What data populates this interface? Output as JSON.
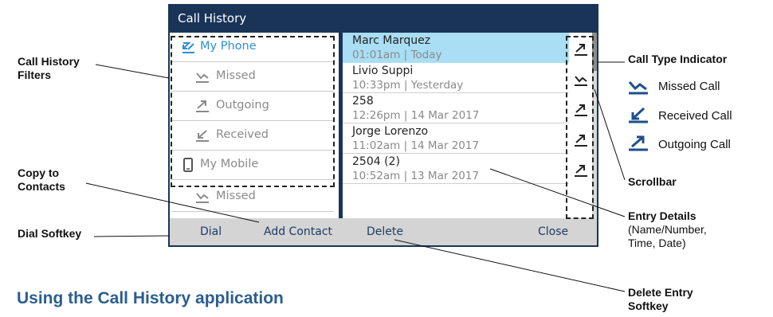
{
  "screen": {
    "title": "Call History",
    "filters": [
      {
        "label": "My Phone",
        "icon": "my-phone-icon",
        "active": true
      },
      {
        "label": "Missed",
        "icon": "missed-call-icon",
        "active": false
      },
      {
        "label": "Outgoing",
        "icon": "outgoing-call-icon",
        "active": false
      },
      {
        "label": "Received",
        "icon": "received-call-icon",
        "active": false
      },
      {
        "label": "My Mobile",
        "icon": "mobile-phone-icon",
        "active": false
      },
      {
        "label": "Missed",
        "icon": "missed-call-icon",
        "active": false
      }
    ],
    "entries": [
      {
        "name": "Marc Marquez",
        "time": "01:01am | Today",
        "type": "outgoing",
        "selected": true
      },
      {
        "name": "Livio Suppi",
        "time": "10:33pm | Yesterday",
        "type": "missed",
        "selected": false
      },
      {
        "name": "258",
        "time": "12:26pm | 14 Mar 2017",
        "type": "outgoing",
        "selected": false
      },
      {
        "name": "Jorge Lorenzo",
        "time": "11:02am | 14 Mar 2017",
        "type": "outgoing",
        "selected": false
      },
      {
        "name": "2504 (2)",
        "time": "10:52am | 13 Mar 2017",
        "type": "outgoing",
        "selected": false
      }
    ],
    "softkeys": {
      "dial": "Dial",
      "add_contact": "Add Contact",
      "delete": "Delete",
      "close": "Close"
    }
  },
  "annotations": {
    "filters_line1": "Call History",
    "filters_line2": "Filters",
    "copy_line1": "Copy to",
    "copy_line2": "Contacts",
    "dial_softkey": "Dial Softkey",
    "call_type_indicator": "Call Type Indicator",
    "legend": {
      "missed": "Missed Call",
      "received": "Received Call",
      "outgoing": "Outgoing Call"
    },
    "scrollbar": "Scrollbar",
    "entry_details_title": "Entry Details",
    "entry_details_line2": "(Name/Number,",
    "entry_details_line3": "Time, Date)",
    "delete_line1": "Delete Entry",
    "delete_line2": "Softkey"
  },
  "heading": "Using the Call History application",
  "colors": {
    "title_bar": "#1a3458",
    "selected_row": "#a9def4",
    "active_filter": "#2d8fd0",
    "softkey_text": "#1d3b66",
    "heading": "#2b5e8f"
  }
}
